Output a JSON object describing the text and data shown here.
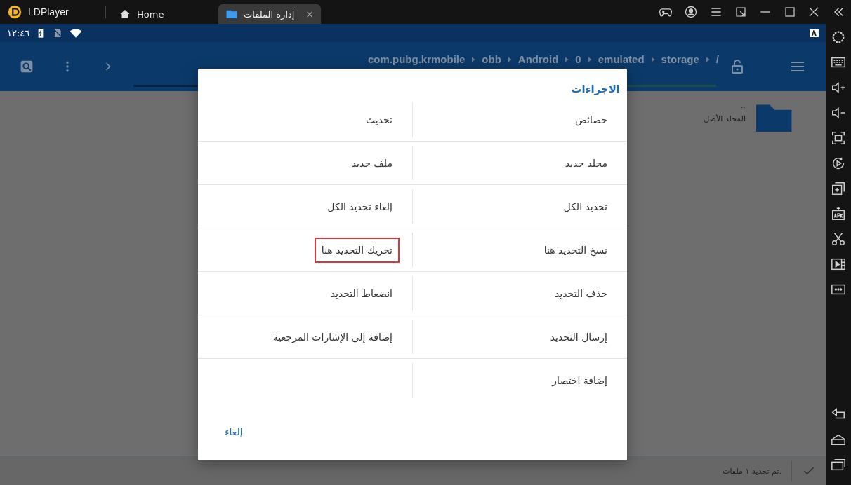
{
  "window": {
    "app_name": "LDPlayer",
    "home_tab": {
      "label": "Home",
      "kind": "home",
      "selected": false
    },
    "files_tab": {
      "label": "إدارة الملفات",
      "kind": "files",
      "selected": true,
      "close": "×"
    }
  },
  "status_bar": {
    "time": "١٢:٤٦",
    "badge": "A"
  },
  "toolbar": {
    "breadcrumb": [
      "/",
      "storage",
      "emulated",
      "0",
      "Android",
      "obb",
      "com.pubg.krmobile"
    ]
  },
  "files": [
    {
      "name": "..",
      "description": "المجلد الأصل"
    }
  ],
  "bottom_bar": {
    "message": "تم تحديد ١ ملفات."
  },
  "dialog": {
    "title": "الاجراءات",
    "rows": [
      [
        {
          "label": "خصائص",
          "highlighted": false
        },
        {
          "label": "تحديث",
          "highlighted": false
        }
      ],
      [
        {
          "label": "مجلد جديد",
          "highlighted": false
        },
        {
          "label": "ملف جديد",
          "highlighted": false
        }
      ],
      [
        {
          "label": "تحديد الكل",
          "highlighted": false
        },
        {
          "label": "إلغاء تحديد الكل",
          "highlighted": false
        }
      ],
      [
        {
          "label": "نسخ التحديد هنا",
          "highlighted": false
        },
        {
          "label": "تحريك التحديد هنا",
          "highlighted": true
        }
      ],
      [
        {
          "label": "حذف التحديد",
          "highlighted": false
        },
        {
          "label": "انضغاط التحديد",
          "highlighted": false
        }
      ],
      [
        {
          "label": "إرسال التحديد",
          "highlighted": false
        },
        {
          "label": "إضافة إلى الإشارات المرجعية",
          "highlighted": false
        }
      ],
      [
        {
          "label": "إضافة اختصار",
          "highlighted": false
        }
      ]
    ],
    "cancel": "إلغاء"
  }
}
